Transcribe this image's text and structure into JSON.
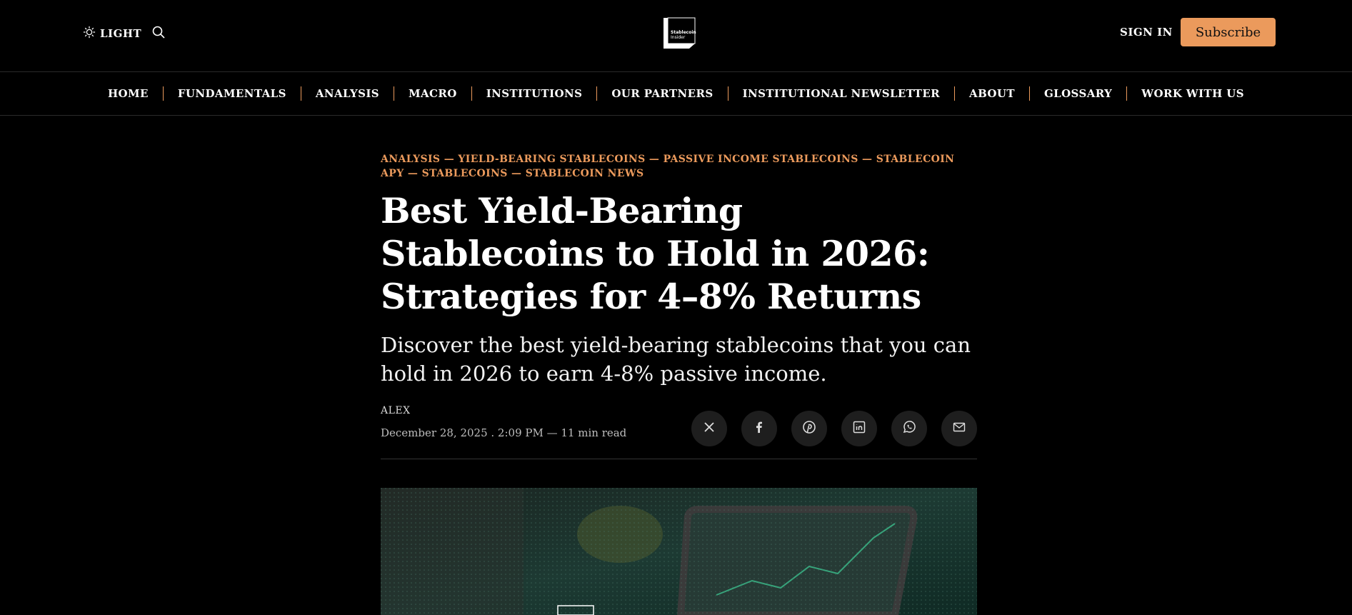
{
  "header": {
    "theme_label": "LIGHT",
    "logo_text_line1": "Stablecoin",
    "logo_text_line2": "Insider",
    "signin_label": "SIGN IN",
    "subscribe_label": "Subscribe"
  },
  "nav": {
    "items": [
      "HOME",
      "FUNDAMENTALS",
      "ANALYSIS",
      "MACRO",
      "INSTITUTIONS",
      "OUR PARTNERS",
      "INSTITUTIONAL NEWSLETTER",
      "ABOUT",
      "GLOSSARY",
      "WORK WITH US"
    ]
  },
  "article": {
    "tags": [
      "ANALYSIS",
      "YIELD-BEARING STABLECOINS",
      "PASSIVE INCOME STABLECOINS",
      "STABLECOIN APY",
      "STABLECOINS",
      "STABLECOIN NEWS"
    ],
    "tag_separator": "—",
    "title": "Best Yield-Bearing Stablecoins to Hold in 2026: Strategies for 4–8% Returns",
    "subtitle": "Discover the best yield-bearing stablecoins that you can hold in 2026 to earn 4-8% passive income.",
    "author": "ALEX",
    "date": "December 28, 2025 . 2:09 PM",
    "read_time": "11 min read",
    "date_separator": "—"
  },
  "share": {
    "icons": [
      "x-icon",
      "facebook-icon",
      "pinterest-icon",
      "linkedin-icon",
      "whatsapp-icon",
      "email-icon"
    ]
  },
  "colors": {
    "accent": "#eb9a5c",
    "background": "#000000"
  }
}
